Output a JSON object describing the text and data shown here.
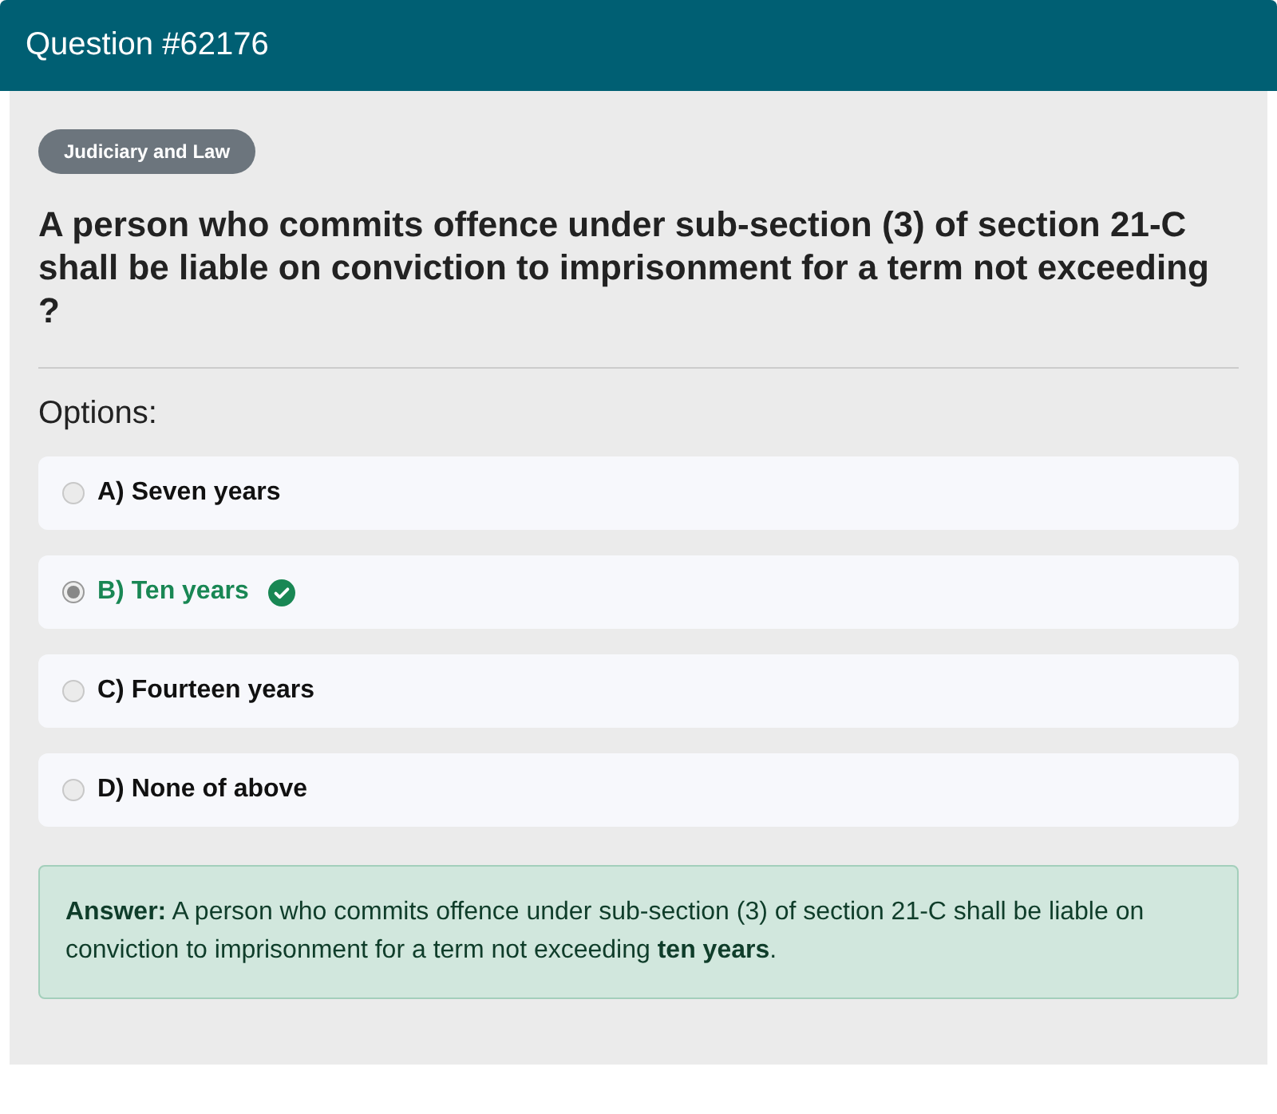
{
  "header": {
    "title": "Question #62176"
  },
  "category": "Judiciary and Law",
  "question": "A person who commits offence under sub-section (3) of section 21-C shall be liable on conviction to imprisonment for a term not exceeding ?",
  "options_label": "Options:",
  "options": [
    {
      "label": "A) Seven years",
      "selected": false,
      "correct": false
    },
    {
      "label": "B) Ten years",
      "selected": true,
      "correct": true
    },
    {
      "label": "C) Fourteen years",
      "selected": false,
      "correct": false
    },
    {
      "label": "D) None of above",
      "selected": false,
      "correct": false
    }
  ],
  "answer": "**Answer:** A person who commits offence under sub-section (3) of section 21-C shall be liable on conviction to imprisonment for a term not exceeding **ten years**."
}
